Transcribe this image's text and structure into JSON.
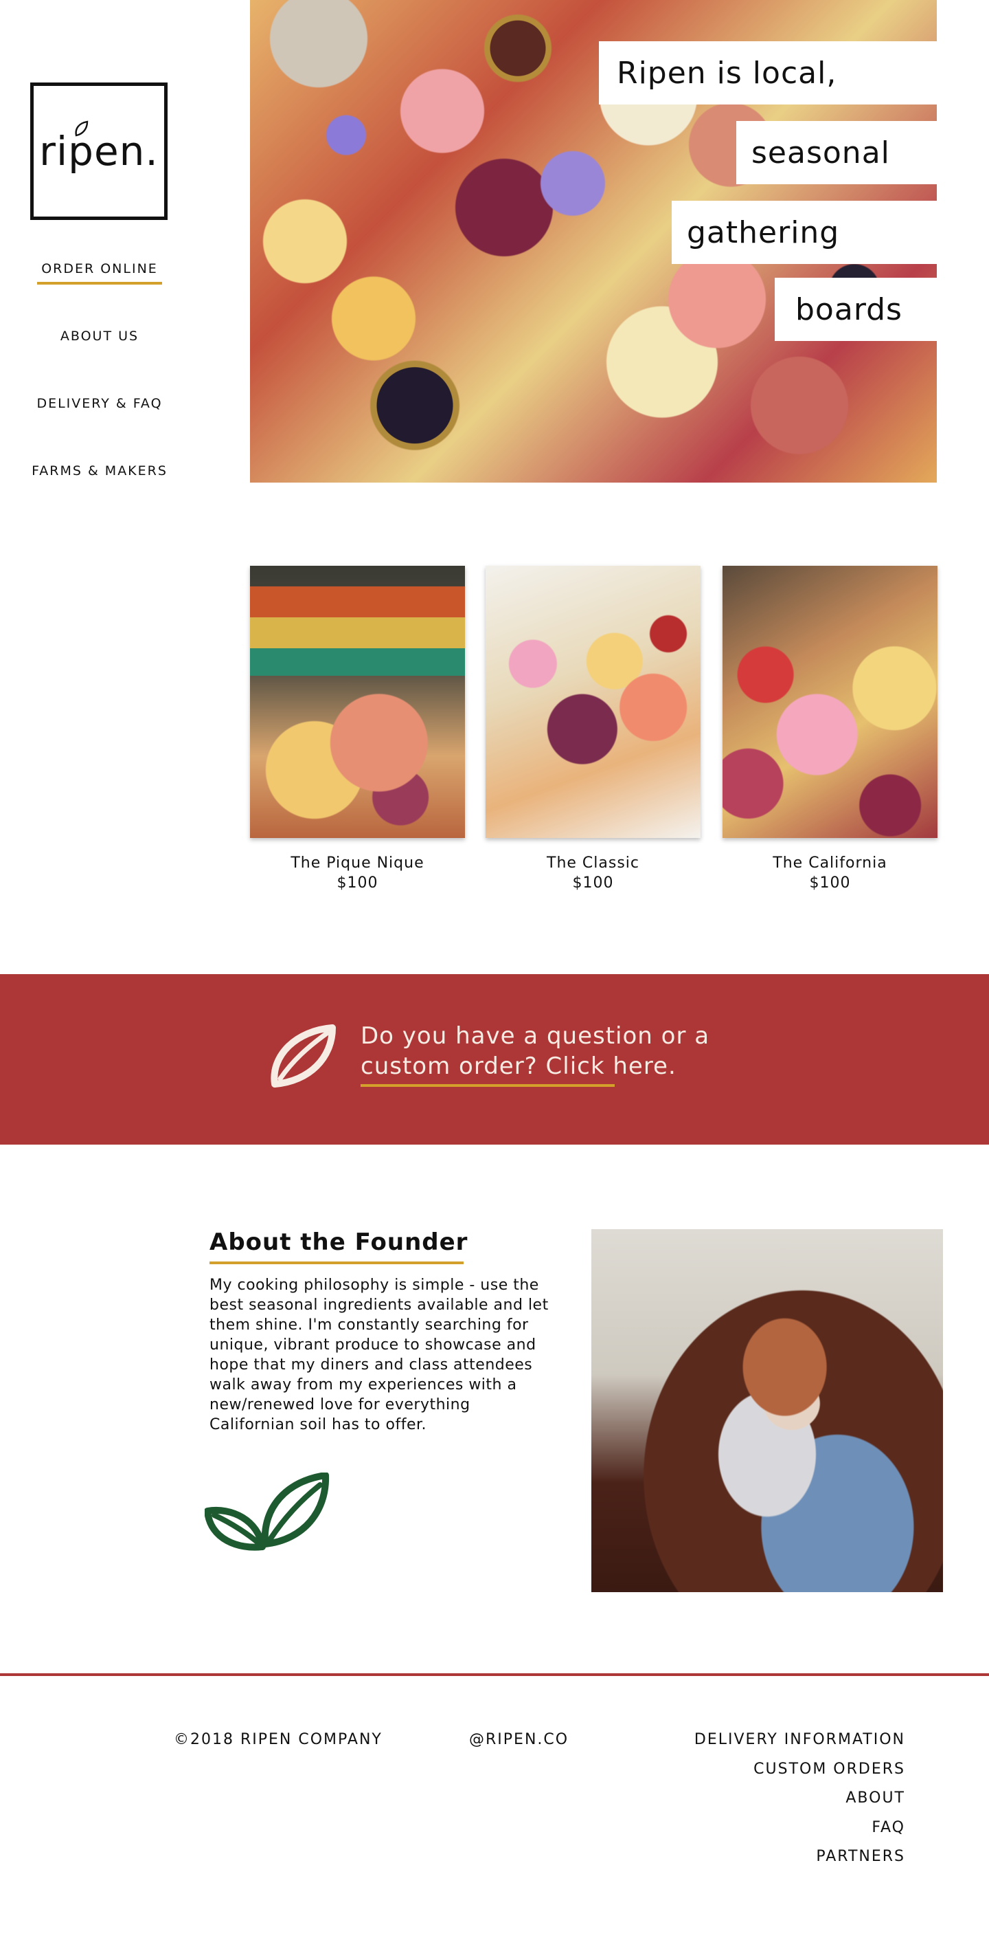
{
  "brand": {
    "logo_text": "ripen."
  },
  "nav": {
    "items": [
      {
        "label": "ORDER ONLINE"
      },
      {
        "label": "ABOUT US"
      },
      {
        "label": "DELIVERY & FAQ"
      },
      {
        "label": "FARMS & MAKERS"
      }
    ]
  },
  "hero": {
    "lines": [
      "Ripen is local,",
      "seasonal",
      "gathering",
      "boards"
    ]
  },
  "products": [
    {
      "name": "The Pique Nique",
      "price": "$100"
    },
    {
      "name": "The Classic",
      "price": "$100"
    },
    {
      "name": "The California",
      "price": "$100"
    }
  ],
  "cta": {
    "line1": "Do you have a question or a",
    "line2": "custom order? Click here."
  },
  "about": {
    "title": "About the Founder",
    "body": "My cooking philosophy is simple - use the best seasonal ingredients available and let them shine. I'm constantly searching for unique, vibrant produce to showcase and hope that my diners and class attendees walk away from my experiences with a new/renewed love for everything Californian soil has to offer."
  },
  "footer": {
    "copyright": "©2018 RIPEN COMPANY",
    "handle": "@RIPEN.CO",
    "links": [
      "DELIVERY INFORMATION",
      "CUSTOM ORDERS",
      "ABOUT",
      "FAQ",
      "PARTNERS"
    ]
  },
  "colors": {
    "accent_gold": "#d3a02b",
    "banner_red": "#ad3637",
    "leaf_green": "#1e5a30"
  },
  "icons": {
    "logo_leaf": "leaf-icon",
    "cta_leaf": "leaf-icon",
    "about_leaves": "double-leaf-icon"
  }
}
